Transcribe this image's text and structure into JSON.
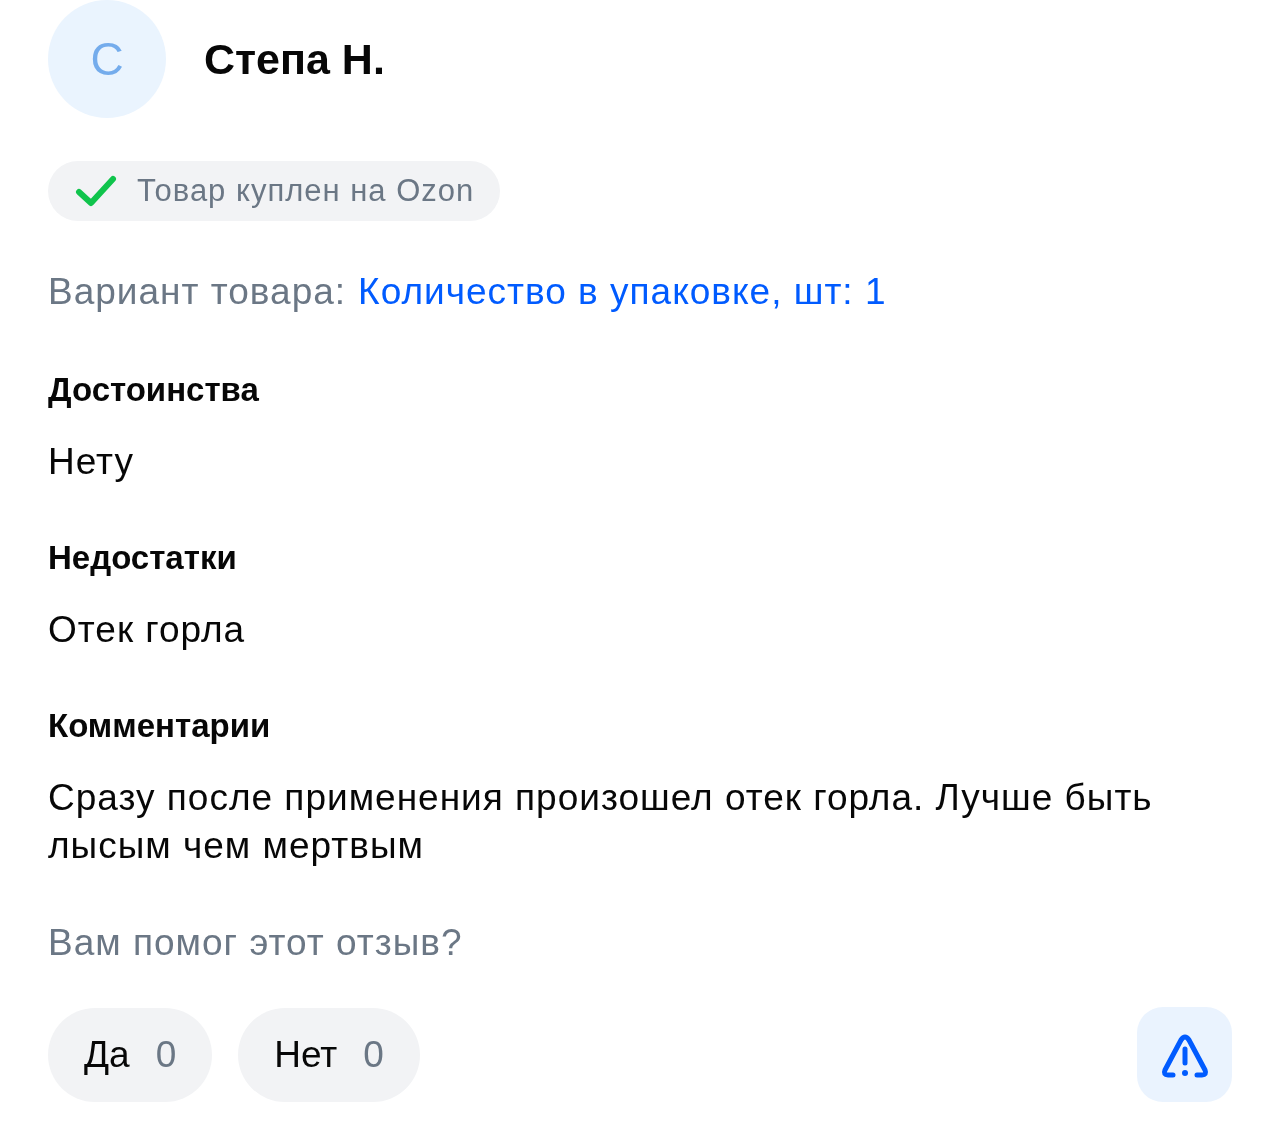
{
  "author": {
    "avatar_letter": "С",
    "name": "Степа Н."
  },
  "purchase_badge": {
    "text": "Товар куплен на Ozon"
  },
  "variant": {
    "label": "Вариант товара:",
    "value": "Количество в упаковке, шт: 1"
  },
  "sections": [
    {
      "title": "Достоинства",
      "text": "Нету"
    },
    {
      "title": "Недостатки",
      "text": "Отек горла"
    },
    {
      "title": "Комментарии",
      "text": "Сразу после применения произошел отек горла. Лучше быть лысым чем мертвым"
    }
  ],
  "helpful": {
    "question": "Вам помог этот отзыв?",
    "votes": [
      {
        "label": "Да",
        "count": "0"
      },
      {
        "label": "Нет",
        "count": "0"
      }
    ]
  }
}
